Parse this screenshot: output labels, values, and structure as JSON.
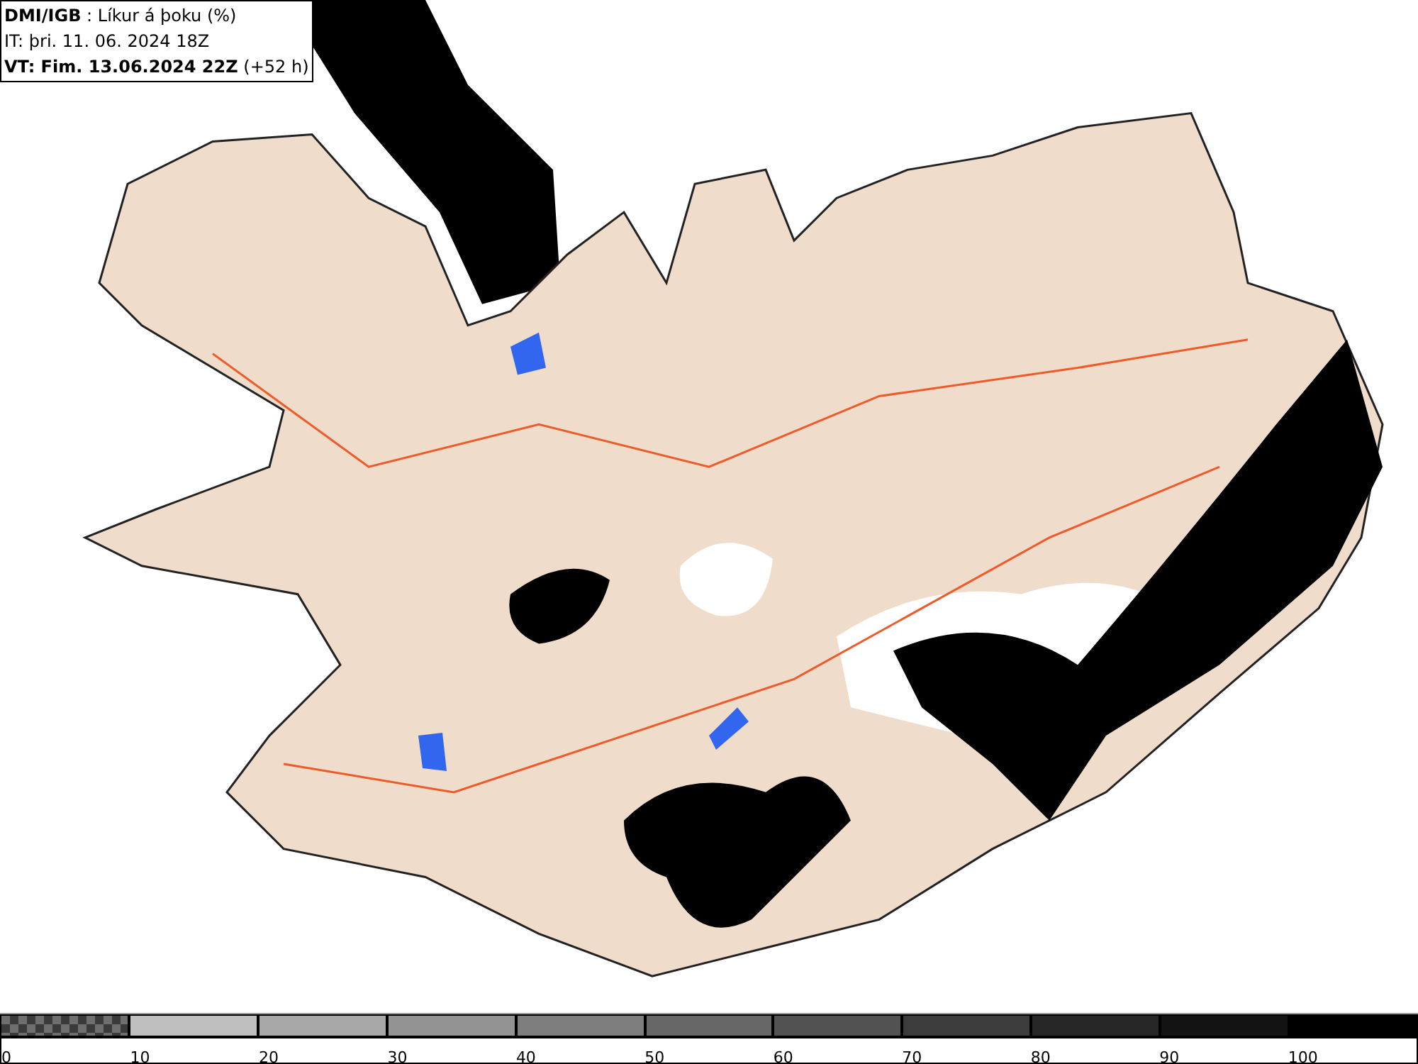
{
  "header": {
    "lines": [
      "**DMI/IGB** : Líkur á þoku (%)",
      "IT: þri. 11. 06. 2024 18Z",
      "**VT: Fim. 13.06.2024 22Z** (+52 h)"
    ]
  },
  "legend": {
    "segments": [
      {
        "kind": "checker",
        "color": "#6e6e6e"
      },
      {
        "kind": "solid",
        "color": "#bfbfbf"
      },
      {
        "kind": "solid",
        "color": "#a8a8a8"
      },
      {
        "kind": "solid",
        "color": "#939393"
      },
      {
        "kind": "solid",
        "color": "#7d7d7d"
      },
      {
        "kind": "solid",
        "color": "#676767"
      },
      {
        "kind": "solid",
        "color": "#525252"
      },
      {
        "kind": "solid",
        "color": "#3c3c3c"
      },
      {
        "kind": "solid",
        "color": "#272727"
      },
      {
        "kind": "solid",
        "color": "#131313"
      },
      {
        "kind": "solid",
        "color": "#000000"
      }
    ],
    "labels": [
      "0",
      "10",
      "20",
      "30",
      "40",
      "50",
      "60",
      "70",
      "80",
      "90",
      "100"
    ]
  }
}
